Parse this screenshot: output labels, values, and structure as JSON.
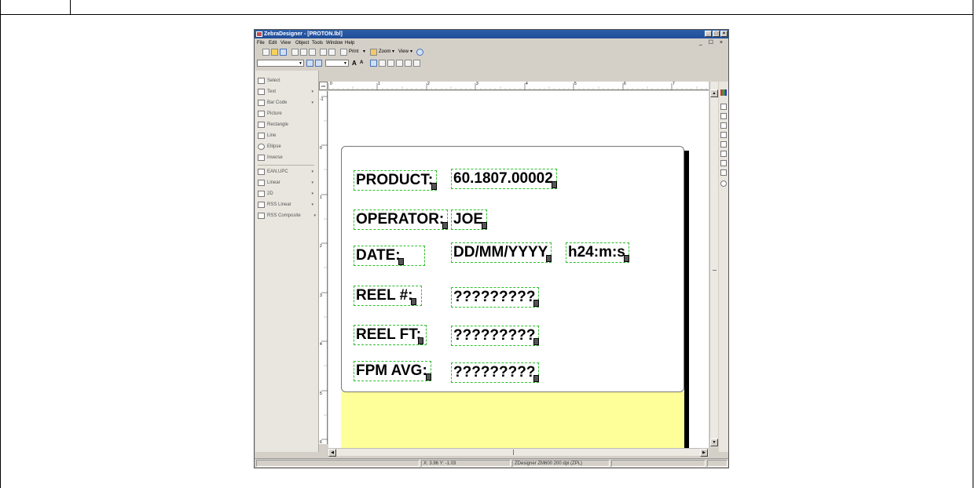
{
  "window": {
    "title": "ZebraDesigner - [PROTON.lbl]",
    "mdi_controls": "_ ☐ ×"
  },
  "menu": [
    "File",
    "Edit",
    "View",
    "Object",
    "Tools",
    "Window",
    "Help"
  ],
  "toolbar": {
    "print": "Print",
    "zoom": "Zoom",
    "view": "View"
  },
  "toolbox": {
    "items": [
      {
        "label": "Select",
        "dropdown": false
      },
      {
        "label": "Text",
        "dropdown": true
      },
      {
        "label": "Bar Code",
        "dropdown": true
      },
      {
        "label": "Picture",
        "dropdown": false
      },
      {
        "label": "Rectangle",
        "dropdown": false
      },
      {
        "label": "Line",
        "dropdown": false
      },
      {
        "label": "Ellipse",
        "dropdown": false
      },
      {
        "label": "Inverse",
        "dropdown": false
      }
    ],
    "barcode_items": [
      {
        "label": "EAN.UPC",
        "dropdown": true
      },
      {
        "label": "Linear",
        "dropdown": true
      },
      {
        "label": "2D",
        "dropdown": true
      },
      {
        "label": "RSS Linear",
        "dropdown": true
      },
      {
        "label": "RSS Composite",
        "dropdown": true
      }
    ]
  },
  "ruler": {
    "unit": "cm",
    "h_ticks": [
      "0",
      "1",
      "2",
      "3",
      "4",
      "5",
      "6",
      "7"
    ],
    "v_ticks": [
      "-1",
      "0",
      "1",
      "2",
      "3",
      "4",
      "5",
      "6"
    ]
  },
  "label": {
    "fields": [
      {
        "id": "product-label",
        "text": "PRODUCT:"
      },
      {
        "id": "product-value",
        "text": "60.1807.00002"
      },
      {
        "id": "operator-label",
        "text": "OPERATOR:"
      },
      {
        "id": "operator-value",
        "text": "JOE"
      },
      {
        "id": "date-label",
        "text": "DATE:"
      },
      {
        "id": "date-value",
        "text": "DD/MM/YYYY"
      },
      {
        "id": "time-value",
        "text": "h24:m:s"
      },
      {
        "id": "reel-number-label",
        "text": "REEL #:"
      },
      {
        "id": "reel-number-value",
        "text": "?????????"
      },
      {
        "id": "reel-ft-label",
        "text": "REEL FT:"
      },
      {
        "id": "reel-ft-value",
        "text": "?????????"
      },
      {
        "id": "fpm-avg-label",
        "text": "FPM AVG:"
      },
      {
        "id": "fpm-avg-value",
        "text": "?????????"
      }
    ]
  },
  "status": {
    "coords": "X: 3.96 Y: -1.03",
    "printer": "ZDesigner ZM600 200 dpi (ZPL)"
  },
  "colors": {
    "titlebar": "#1f4d99",
    "label_bg": "#ffffff",
    "unprintable_area": "#ffff99",
    "field_border": "#2fbf2f"
  }
}
